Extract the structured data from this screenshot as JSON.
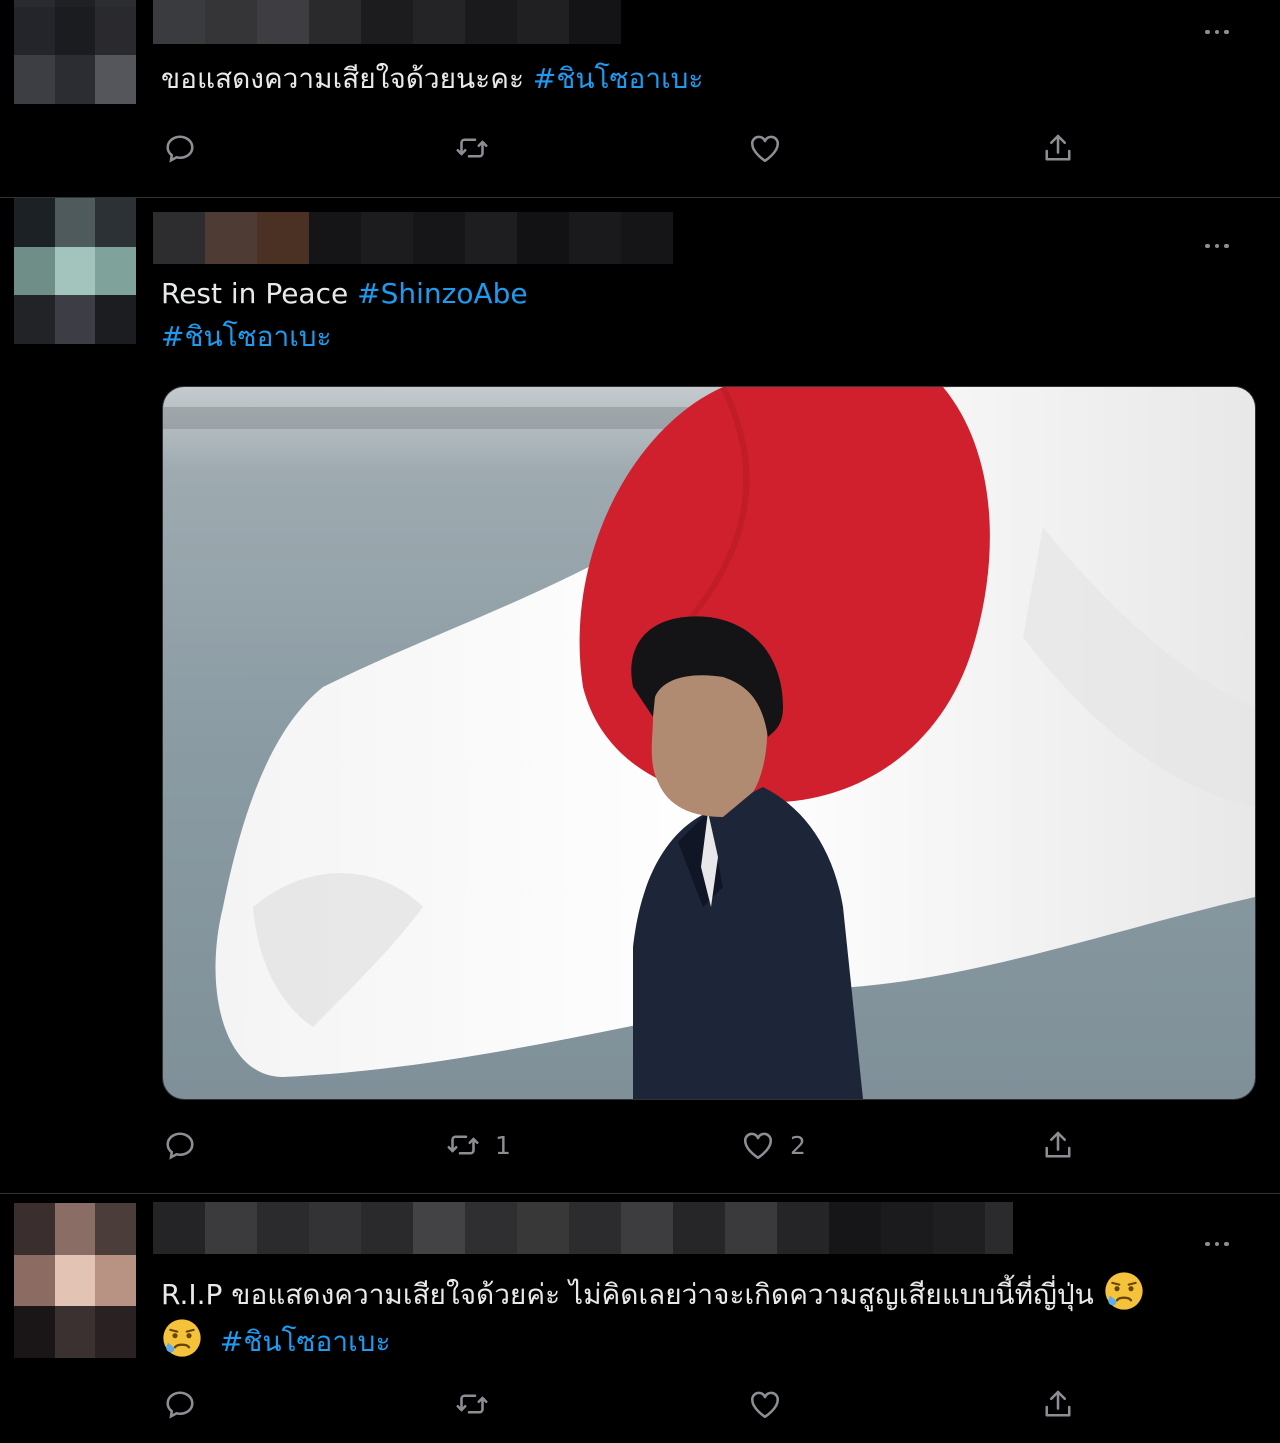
{
  "tweets": [
    {
      "text": "ขอแสดงความเสียใจด้วยนะคะ ",
      "hashtags": [
        "#ชินโซอาเบะ"
      ],
      "actions": {
        "reply": "",
        "retweet": "",
        "like": ""
      }
    },
    {
      "text": "Rest in Peace ",
      "hashtags": [
        "#ShinzoAbe",
        "#ชินโซอาเบะ"
      ],
      "actions": {
        "reply": "",
        "retweet": "1",
        "like": "2"
      }
    },
    {
      "text": "R.I.P ขอแสดงความเสียใจด้วยค่ะ ไม่คิดเลยว่าจะเกิดความสูญเสียแบบนี้ที่ญี่ปุ่น",
      "hashtags": [
        "#ชินโซอาเบะ"
      ],
      "actions": {
        "reply": "",
        "retweet": "",
        "like": ""
      },
      "emoji": "sad-relieved-face"
    }
  ],
  "colors": {
    "background": "#000000",
    "hashtag": "#1d9bf0",
    "muted": "#8b8f94",
    "divider": "#2f3336"
  },
  "icons": [
    "reply-icon",
    "retweet-icon",
    "like-icon",
    "share-icon",
    "more-icon"
  ]
}
